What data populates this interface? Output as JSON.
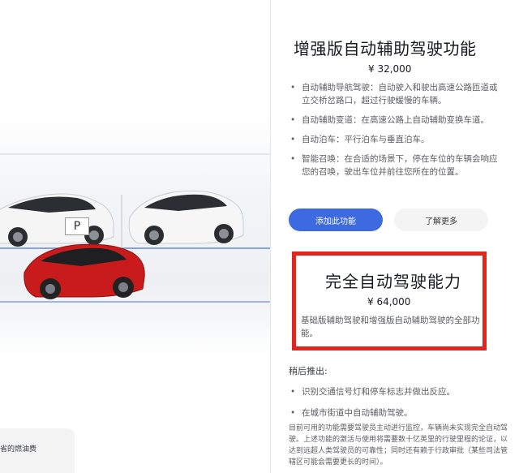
{
  "enhanced_autopilot": {
    "title": "增强版自动辅助驾驶功能",
    "price": "¥ 32,000",
    "features": [
      "自动辅助导航驾驶：自动驶入和驶出高速公路匝道或立交桥岔路口，超过行驶缓慢的车辆。",
      "自动辅助变道：在高速公路上自动辅助变换车道。",
      "自动泊车：平行泊车与垂直泊车。",
      "智能召唤：在合适的场景下，停在车位的车辆会响应您的召唤，驶出车位并前往您所在的位置。"
    ],
    "add_button": "添加此功能",
    "learn_button": "了解更多"
  },
  "fsd": {
    "title": "完全自动驾驶能力",
    "price": "¥ 64,000",
    "description": "基础版辅助驾驶和增强版自动辅助驾驶的全部功能。"
  },
  "coming_later": {
    "heading": "稍后推出:",
    "items": [
      "识别交通信号灯和停车标志并做出反应。",
      "在城市街道中自动辅助驾驶。"
    ],
    "note": "目前可用的功能需要驾驶员主动进行监控，车辆尚未实现完全自动驾驶。上述功能的激活与使用将需要数十亿英里的行驶里程的论证，以达到远超人类驾驶员的可靠性；同时还有赖于行政审批（某些司法管辖区可能会需要更长的时间）。"
  },
  "illustration": {
    "parking_sign": "P"
  },
  "bottom_card": {
    "text": "省的燃油费"
  },
  "colors": {
    "accent_blue": "#3e6ae1",
    "highlight_red": "#e3241b",
    "car_red": "#cc1b1b",
    "car_white": "#f2f2f2"
  }
}
